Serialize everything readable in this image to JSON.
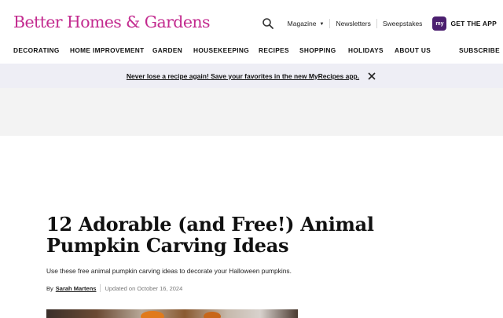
{
  "header": {
    "logo": "Better Homes & Gardens",
    "links": {
      "magazine": "Magazine",
      "newsletters": "Newsletters",
      "sweepstakes": "Sweepstakes"
    },
    "app_badge": "my",
    "app_label": "GET THE APP",
    "brand_color": "#c32b8f"
  },
  "nav": {
    "items": [
      "DECORATING",
      "HOME IMPROVEMENT",
      "GARDEN",
      "HOUSEKEEPING",
      "RECIPES",
      "SHOPPING",
      "HOLIDAYS",
      "ABOUT US"
    ],
    "subscribe": "SUBSCRIBE"
  },
  "promo": {
    "text": "Never lose a recipe again! Save your favorites in the new MyRecipes app."
  },
  "article": {
    "title": "12 Adorable (and Free!) Animal Pumpkin Carving Ideas",
    "dek": "Use these free animal pumpkin carving ideas to decorate your Halloween pumpkins.",
    "by": "By",
    "author": "Sarah Martens",
    "updated": "Updated on October 16, 2024"
  },
  "icons": {
    "search": "search-icon",
    "dropdown": "caret-down-icon",
    "close": "close-icon"
  }
}
